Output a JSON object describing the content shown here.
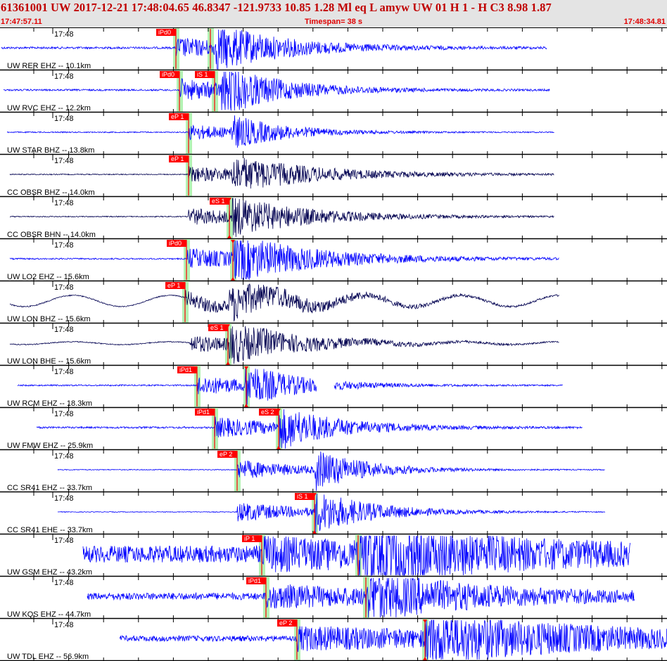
{
  "header": {
    "event_line": "61361001 UW 2017-12-21 17:48:04.65   46.8347 -121.9733  10.85  1.28 Ml  eq  L amyw     UW 01  H   1  -  H C3    8.98  1.87",
    "start_time": "17:47:57.11",
    "timespan": "Timespan=  38 s",
    "end_time": "17:48:34.81"
  },
  "colors": {
    "pick_red": "#ff0000",
    "window_green": "#b3f2b3",
    "trace_blue": "#0000ff",
    "trace_navy": "#000050",
    "header_red": "#c00000"
  },
  "panels": [
    {
      "label": "UW RER EHZ -- 10.1km",
      "time_label": "17:48",
      "color": "#0000ff",
      "picks": [
        {
          "text": "iPd0",
          "t": 250
        },
        {
          "text": "",
          "t": 299
        }
      ],
      "signal": {
        "start": 2,
        "end": 777,
        "onset": 250,
        "s": 306,
        "amp": 26,
        "noise": 1.5,
        "decay": 90
      }
    },
    {
      "label": "UW RVC EHZ -- 12.2km",
      "time_label": "17:48",
      "color": "#0000ff",
      "picks": [
        {
          "text": "iPd0",
          "t": 255
        },
        {
          "text": "iS 1",
          "t": 305
        }
      ],
      "signal": {
        "start": 5,
        "end": 782,
        "onset": 256,
        "s": 315,
        "amp": 28,
        "noise": 1.2,
        "decay": 80
      }
    },
    {
      "label": "UW STAR BHZ -- 13.8km",
      "time_label": "17:48",
      "color": "#0000ff",
      "picks": [
        {
          "text": "eP 1",
          "t": 268
        }
      ],
      "signal": {
        "start": 10,
        "end": 788,
        "onset": 268,
        "s": 328,
        "amp": 20,
        "noise": 0.8,
        "decay": 70
      }
    },
    {
      "label": "CC OBSR BHZ -- 14.0km",
      "time_label": "17:48",
      "color": "#000050",
      "picks": [
        {
          "text": "eP 1",
          "t": 268
        }
      ],
      "signal": {
        "start": 14,
        "end": 788,
        "onset": 268,
        "s": 330,
        "amp": 20,
        "noise": 0.7,
        "decay": 110
      }
    },
    {
      "label": "CC OBSR BHN -- 14.0km",
      "time_label": "17:48",
      "color": "#000050",
      "picks": [
        {
          "text": "eS 1",
          "t": 326,
          "tri": true
        }
      ],
      "signal": {
        "start": 14,
        "end": 788,
        "onset": 268,
        "s": 330,
        "amp": 22,
        "noise": 0.7,
        "decay": 100
      }
    },
    {
      "label": "UW LO2 EHZ -- 15.6km",
      "time_label": "17:48",
      "color": "#0000ff",
      "picks": [
        {
          "text": "iPd0",
          "t": 265
        },
        {
          "text": "",
          "t": 331,
          "tri": true
        }
      ],
      "signal": {
        "start": 14,
        "end": 795,
        "onset": 266,
        "s": 333,
        "amp": 26,
        "noise": 1.0,
        "decay": 110
      }
    },
    {
      "label": "UW LON BHZ -- 15.6km",
      "time_label": "17:48",
      "color": "#000050",
      "picks": [
        {
          "text": "eP 1",
          "t": 263
        }
      ],
      "signal": {
        "start": 14,
        "end": 795,
        "onset": 263,
        "s": 326,
        "amp": 20,
        "noise": 0.8,
        "decay": 100,
        "wave": 8
      }
    },
    {
      "label": "UW LON BHE -- 15.6km",
      "time_label": "17:48",
      "color": "#000050",
      "picks": [
        {
          "text": "eS 1",
          "t": 324,
          "tri": true
        }
      ],
      "signal": {
        "start": 14,
        "end": 795,
        "onset": 270,
        "s": 326,
        "amp": 22,
        "noise": 0.7,
        "decay": 95,
        "wave": 2
      }
    },
    {
      "label": "UW RCM EHZ -- 18.3km",
      "time_label": "17:48",
      "color": "#0000ff",
      "picks": [
        {
          "text": "iPd1",
          "t": 280
        },
        {
          "text": "",
          "t": 350,
          "tri": true
        }
      ],
      "signal": {
        "start": 25,
        "end": 800,
        "onset": 280,
        "s": 348,
        "amp": 26,
        "noise": 1.0,
        "decay": 70,
        "gap": [
          450,
          475
        ]
      }
    },
    {
      "label": "UW FMW EHZ -- 25.9km",
      "time_label": "17:48",
      "color": "#0000ff",
      "picks": [
        {
          "text": "iPd1",
          "t": 305
        },
        {
          "text": "eS 2",
          "t": 396,
          "tri": true
        }
      ],
      "signal": {
        "start": 52,
        "end": 828,
        "onset": 305,
        "s": 397,
        "amp": 26,
        "noise": 1.3,
        "decay": 80
      }
    },
    {
      "label": "CC SR41 EHZ -- 33.7km",
      "time_label": "17:48",
      "color": "#0000ff",
      "picks": [
        {
          "text": "eP 2",
          "t": 337
        }
      ],
      "signal": {
        "start": 82,
        "end": 860,
        "onset": 337,
        "s": 448,
        "amp": 26,
        "noise": 0.6,
        "decay": 70
      }
    },
    {
      "label": "CC SR41 EHE -- 33.7km",
      "time_label": "17:48",
      "color": "#0000ff",
      "picks": [
        {
          "text": "iS 1",
          "t": 447,
          "tri": true
        }
      ],
      "signal": {
        "start": 82,
        "end": 860,
        "onset": 337,
        "s": 448,
        "amp": 26,
        "noise": 0.5,
        "decay": 80
      }
    },
    {
      "label": "UW GSM EHZ -- 43.2km",
      "time_label": "17:48",
      "color": "#0000ff",
      "picks": [
        {
          "text": "iP 1",
          "t": 372
        },
        {
          "text": "",
          "t": 509
        }
      ],
      "signal": {
        "start": 118,
        "end": 896,
        "onset": 372,
        "s": 509,
        "amp": 28,
        "noise": 12,
        "decay": 200
      }
    },
    {
      "label": "UW KQS EHZ -- 44.7km",
      "time_label": "17:48",
      "color": "#0000ff",
      "picks": [
        {
          "text": "iPd1",
          "t": 378
        },
        {
          "text": "",
          "t": 520
        }
      ],
      "signal": {
        "start": 124,
        "end": 902,
        "onset": 378,
        "s": 520,
        "amp": 26,
        "noise": 5,
        "decay": 160
      }
    },
    {
      "label": "UW TDL EHZ -- 56.9km",
      "time_label": "17:48",
      "color": "#0000ff",
      "picks": [
        {
          "text": "eP 2",
          "t": 422
        },
        {
          "text": "",
          "t": 604,
          "tri": true
        }
      ],
      "signal": {
        "start": 170,
        "end": 948,
        "onset": 422,
        "s": 604,
        "amp": 28,
        "noise": 4,
        "decay": 250
      }
    }
  ]
}
